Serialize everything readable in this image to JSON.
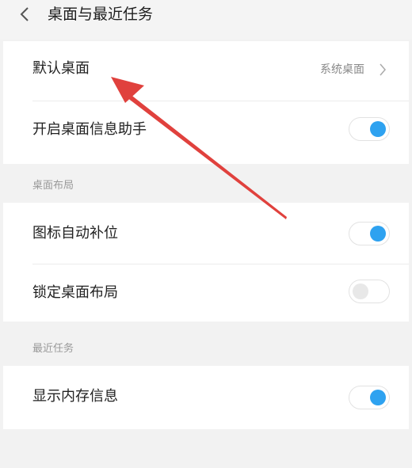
{
  "header": {
    "title": "桌面与最近任务"
  },
  "rows": {
    "default_desktop": {
      "label": "默认桌面",
      "value": "系统桌面"
    },
    "desktop_assistant": {
      "label": "开启桌面信息助手",
      "toggle": "on"
    },
    "icon_autofill": {
      "label": "图标自动补位",
      "toggle": "on"
    },
    "lock_layout": {
      "label": "锁定桌面布局",
      "toggle": "off"
    },
    "show_memory": {
      "label": "显示内存信息",
      "toggle": "on"
    }
  },
  "sections": {
    "layout": "桌面布局",
    "recent": "最近任务"
  },
  "colors": {
    "accent": "#2ea2f0",
    "annotation_arrow": "#e0413d"
  },
  "icons": [
    "back-chevron",
    "right-chevron"
  ]
}
